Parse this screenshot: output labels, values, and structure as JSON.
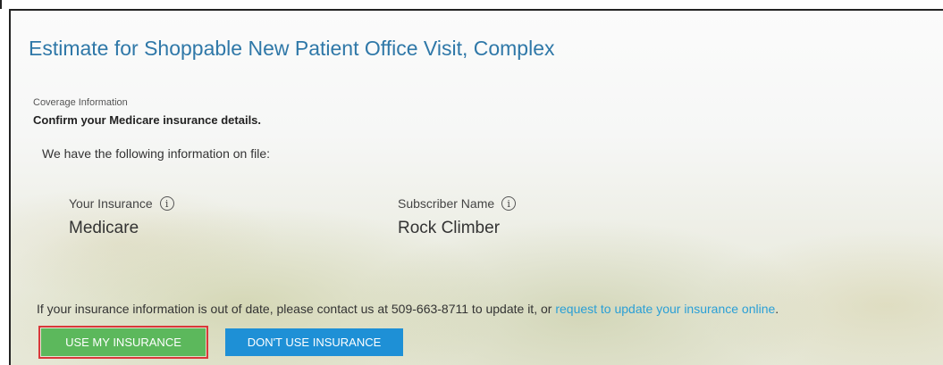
{
  "estimate": {
    "title": "Estimate for Shoppable New Patient Office Visit, Complex"
  },
  "coverage": {
    "section_label": "Coverage Information",
    "subheading": "Confirm your Medicare insurance details.",
    "on_file_text": "We have the following information on file:",
    "insurance": {
      "label": "Your Insurance",
      "value": "Medicare",
      "icon": "info-icon"
    },
    "subscriber": {
      "label": "Subscriber Name",
      "value": "Rock Climber",
      "icon": "info-icon"
    }
  },
  "notice": {
    "text": "If your insurance information is out of date, please contact us at 509-663-8711 to update it, or ",
    "link_text": "request to update your insurance online",
    "trailing": "."
  },
  "actions": {
    "use_insurance_label": "USE MY INSURANCE",
    "dont_use_insurance_label": "DON'T USE INSURANCE"
  },
  "colors": {
    "title": "#2f78a8",
    "link": "#2a9fd6",
    "use_button": "#5cb85c",
    "dont_use_button": "#1e90d6",
    "highlight_outline": "#d9383a"
  }
}
